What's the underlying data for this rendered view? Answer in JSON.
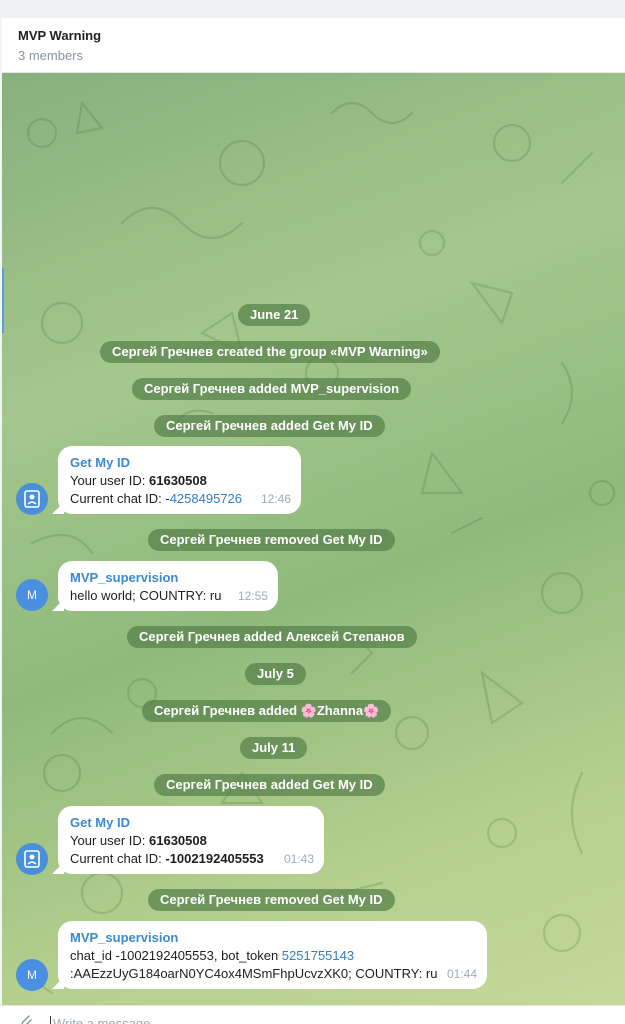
{
  "header": {
    "title": "MVP Warning",
    "subtitle": "3 members"
  },
  "service": {
    "date1": "June 21",
    "created": "Сергей Гречнев created the group «MVP Warning»",
    "added_mvp": "Сергей Гречнев added MVP_supervision",
    "added_getmyid": "Сергей Гречнев added Get My ID",
    "removed_getmyid": "Сергей Гречнев removed Get My ID",
    "added_aleksey": "Сергей Гречнев added Алексей Степанов",
    "date2": "July 5",
    "added_zhanna": "Сергей Гречнев added 🌸Zhanna🌸",
    "date3": "July 11",
    "added_getmyid2": "Сергей Гречнев added Get My ID",
    "removed_getmyid2": "Сергей Гречнев removed Get My ID"
  },
  "messages": {
    "m1": {
      "sender": "Get My ID",
      "l1_label": "Your user ID: ",
      "l1_value": "61630508",
      "l2_label": "Current chat ID: -",
      "l2_value": "4258495726",
      "time": "12:46"
    },
    "m2": {
      "sender": "MVP_supervision",
      "text": "hello world; COUNTRY: ru",
      "time": "12:55",
      "avatar": "M"
    },
    "m3": {
      "sender": "Get My ID",
      "l1_label": "Your user ID: ",
      "l1_value": "61630508",
      "l2_label": "Current chat ID: ",
      "l2_value": "-1002192405553",
      "time": "01:43"
    },
    "m4": {
      "sender": "MVP_supervision",
      "l1_text": "chat_id -1002192405553, bot_token ",
      "l1_link": "5251755143",
      "l2_text": ":AAEzzUyG184oarN0YC4ox4MSmFhpUcvzXK0; COUNTRY: ru",
      "time": "01:44",
      "avatar": "M"
    }
  },
  "composer": {
    "placeholder": "Write a message..."
  },
  "colors": {
    "accent": "#3a8ad1",
    "service_bg": "#56804 9",
    "bubble": "#ffffff"
  }
}
